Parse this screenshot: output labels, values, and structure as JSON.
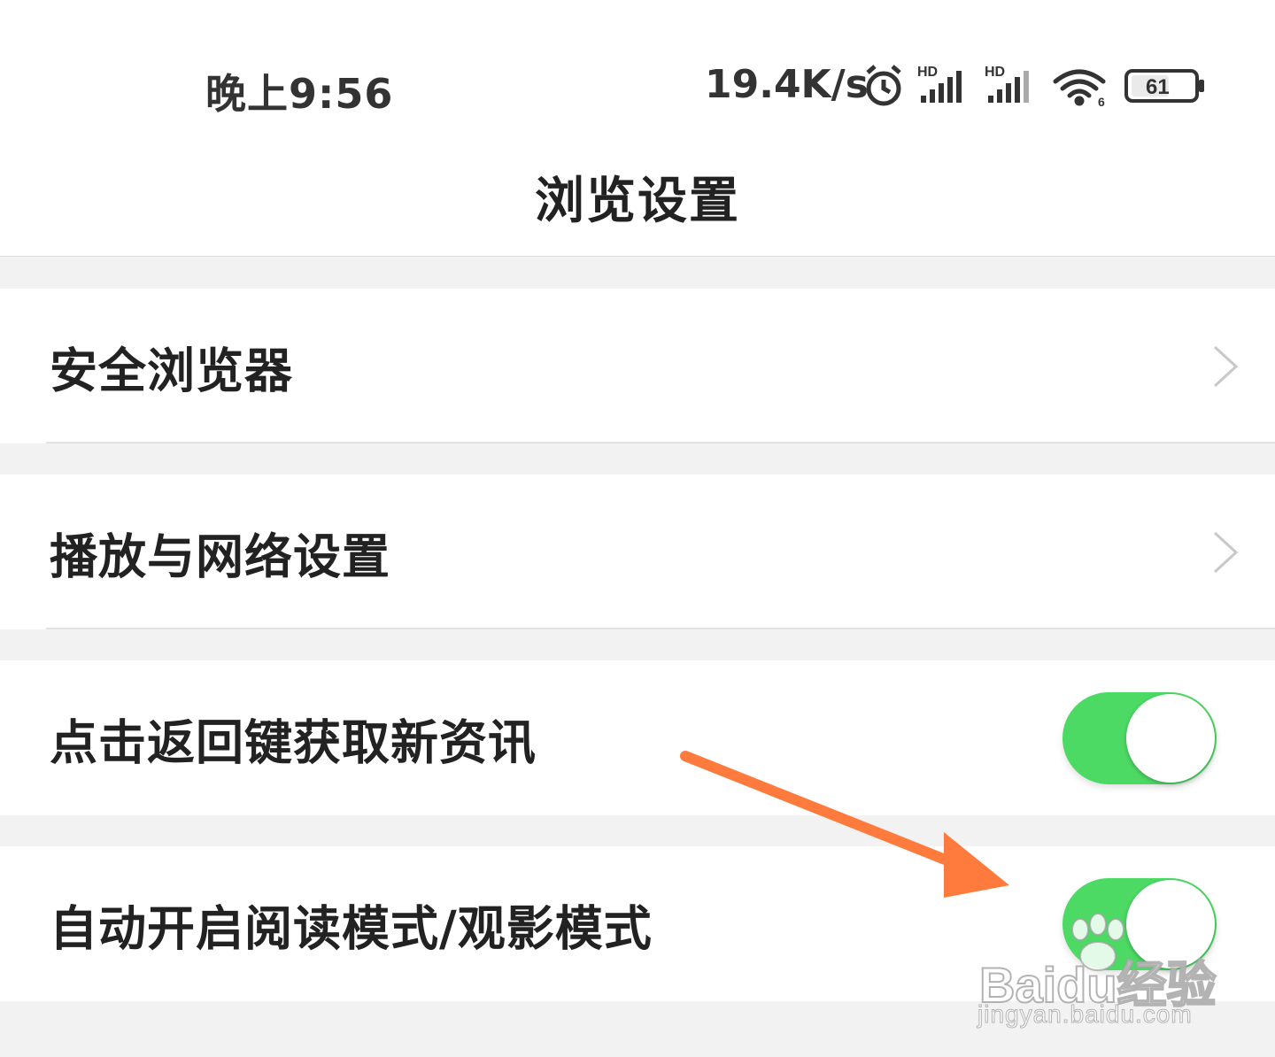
{
  "status_bar": {
    "time": "晚上9:56",
    "network_speed": "19.4K/s",
    "battery_level": "61",
    "icons": [
      "alarm-icon",
      "hd-signal-icon",
      "hd-signal-icon",
      "wifi-icon",
      "battery-icon"
    ]
  },
  "header": {
    "title": "浏览设置"
  },
  "settings": {
    "items": [
      {
        "label": "安全浏览器",
        "control": "chevron"
      },
      {
        "label": "播放与网络设置",
        "control": "chevron"
      },
      {
        "label": "点击返回键获取新资讯",
        "control": "toggle",
        "enabled": true
      },
      {
        "label": "自动开启阅读模式/观影模式",
        "control": "toggle",
        "enabled": true
      }
    ]
  },
  "colors": {
    "toggle_on": "#4cd964",
    "annotation_arrow": "#ff7a3d"
  },
  "watermark": {
    "brand": "Baidu经验",
    "url": "jingyan.baidu.com"
  }
}
